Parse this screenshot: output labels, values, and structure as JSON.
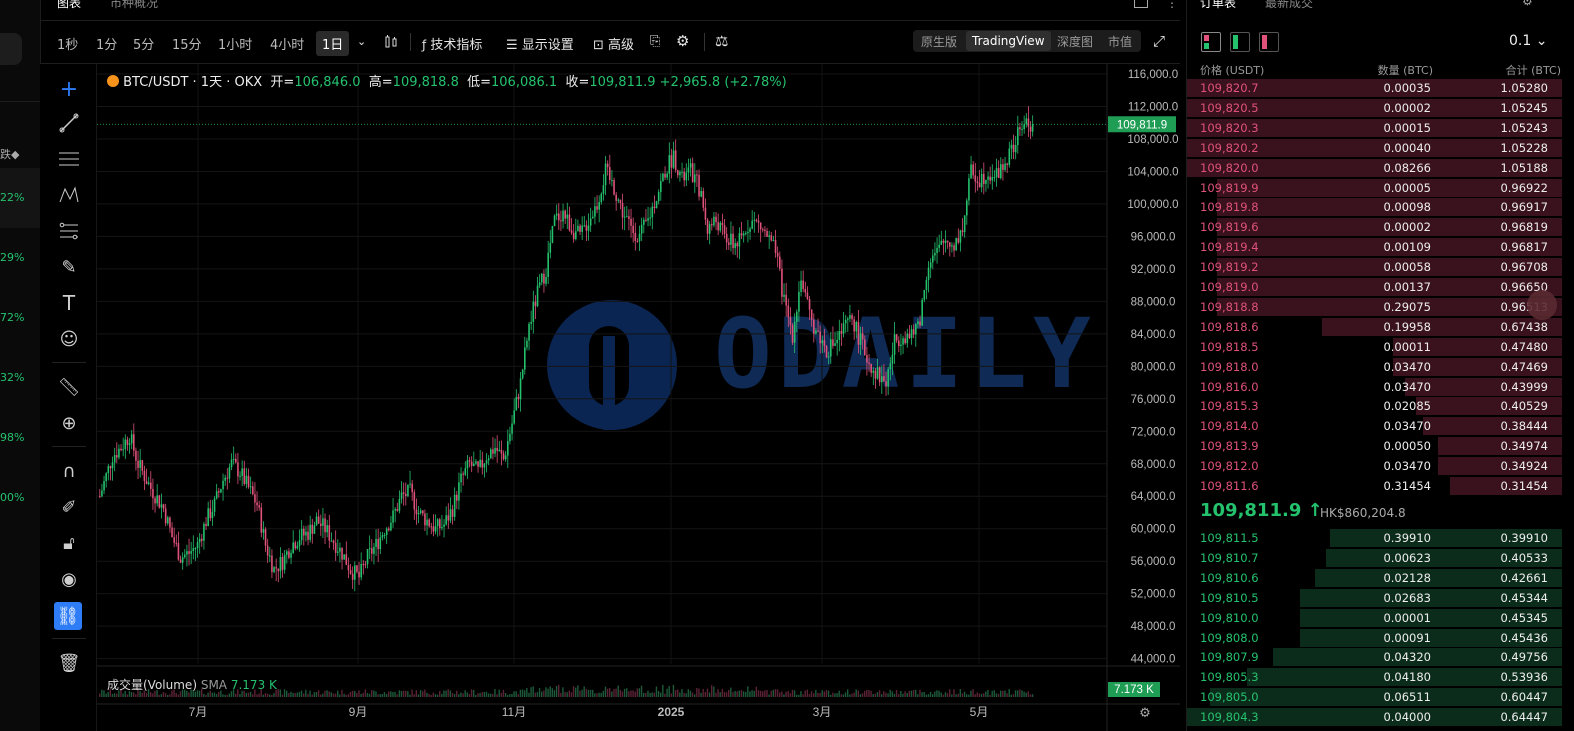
{
  "left_panel": {
    "header": "跌◆",
    "percents": [
      "22%",
      "29%",
      "72%",
      "32%",
      "98%",
      "00%"
    ]
  },
  "top_tabs": [
    "图表",
    "市种概况"
  ],
  "toolbar": {
    "timeframes": [
      "1秒",
      "1分",
      "5分",
      "15分",
      "1小时",
      "4小时",
      "1日"
    ],
    "active_timeframe": "1日",
    "indicators_label": "技术指标",
    "display_label": "显示设置",
    "advanced_label": "高级",
    "views": [
      "原生版",
      "TradingView",
      "深度图",
      "市值"
    ],
    "active_view": "TradingView"
  },
  "legend": {
    "symbol": "BTC/USDT · 1天 · OKX",
    "open_label": "开=",
    "open": "106,846.0",
    "high_label": "高=",
    "high": "109,818.8",
    "low_label": "低=",
    "low": "106,086.1",
    "close_label": "收=",
    "close": "109,811.9",
    "change": "+2,965.8 (+2.78%)"
  },
  "volume_legend": {
    "name": "成交量(Volume)",
    "sma_label": "SMA",
    "sma_value": "7.173 K"
  },
  "watermark": "ODAILY",
  "chart_data": {
    "type": "candlestick",
    "y_ticks": [
      "116,000.0",
      "112,000.0",
      "108,000.0",
      "104,000.0",
      "100,000.0",
      "96,000.0",
      "92,000.0",
      "88,000.0",
      "84,000.0",
      "80,000.0",
      "76,000.0",
      "72,000.0",
      "68,000.0",
      "64,000.0",
      "60,000.0",
      "56,000.0",
      "52,000.0",
      "48,000.0",
      "44,000.0"
    ],
    "x_ticks": [
      "7月",
      "9月",
      "11月",
      "2025",
      "3月",
      "5月"
    ],
    "last_price_label": "109,811.9",
    "volume_label": "7.173 K",
    "ylim": [
      43000,
      117000
    ],
    "path": [
      [
        0,
        64
      ],
      [
        6,
        69
      ],
      [
        10,
        70
      ],
      [
        14,
        71.5
      ],
      [
        18,
        68
      ],
      [
        24,
        65
      ],
      [
        30,
        62.5
      ],
      [
        34,
        59
      ],
      [
        38,
        56.5
      ],
      [
        42,
        57
      ],
      [
        46,
        58
      ],
      [
        50,
        61
      ],
      [
        54,
        63
      ],
      [
        58,
        66
      ],
      [
        62,
        68
      ],
      [
        66,
        67
      ],
      [
        70,
        65
      ],
      [
        74,
        63
      ],
      [
        78,
        58
      ],
      [
        82,
        55
      ],
      [
        86,
        56
      ],
      [
        90,
        58
      ],
      [
        94,
        59
      ],
      [
        98,
        59.5
      ],
      [
        102,
        61
      ],
      [
        106,
        60
      ],
      [
        110,
        58.5
      ],
      [
        114,
        57
      ],
      [
        118,
        55
      ],
      [
        122,
        54
      ],
      [
        126,
        56.5
      ],
      [
        130,
        58
      ],
      [
        134,
        60
      ],
      [
        138,
        61.5
      ],
      [
        142,
        64
      ],
      [
        146,
        64.5
      ],
      [
        150,
        62
      ],
      [
        154,
        61
      ],
      [
        158,
        60
      ],
      [
        162,
        60.5
      ],
      [
        166,
        62.5
      ],
      [
        170,
        66
      ],
      [
        174,
        68
      ],
      [
        178,
        67
      ],
      [
        182,
        69
      ],
      [
        186,
        70
      ],
      [
        190,
        68.5
      ],
      [
        194,
        73
      ],
      [
        198,
        78
      ],
      [
        202,
        85
      ],
      [
        206,
        89
      ],
      [
        210,
        92
      ],
      [
        214,
        98
      ],
      [
        218,
        99
      ],
      [
        222,
        97
      ],
      [
        226,
        96
      ],
      [
        230,
        98
      ],
      [
        234,
        100
      ],
      [
        238,
        104
      ],
      [
        242,
        102
      ],
      [
        246,
        99
      ],
      [
        250,
        97
      ],
      [
        254,
        96
      ],
      [
        258,
        98
      ],
      [
        262,
        101
      ],
      [
        266,
        104
      ],
      [
        270,
        106
      ],
      [
        274,
        103
      ],
      [
        278,
        104
      ],
      [
        282,
        102
      ],
      [
        286,
        97
      ],
      [
        290,
        98
      ],
      [
        294,
        96
      ],
      [
        298,
        95
      ],
      [
        302,
        95.5
      ],
      [
        306,
        98
      ],
      [
        310,
        97.5
      ],
      [
        314,
        96
      ],
      [
        318,
        94
      ],
      [
        322,
        88
      ],
      [
        326,
        84
      ],
      [
        330,
        91
      ],
      [
        334,
        86
      ],
      [
        338,
        84
      ],
      [
        342,
        82
      ],
      [
        346,
        83
      ],
      [
        350,
        84.5
      ],
      [
        354,
        86
      ],
      [
        358,
        83
      ],
      [
        362,
        80.5
      ],
      [
        366,
        79
      ],
      [
        370,
        78
      ],
      [
        374,
        83
      ],
      [
        378,
        84
      ],
      [
        382,
        83.5
      ],
      [
        386,
        86
      ],
      [
        390,
        93
      ],
      [
        394,
        94
      ],
      [
        398,
        95.5
      ],
      [
        402,
        95
      ],
      [
        406,
        97
      ],
      [
        410,
        104
      ],
      [
        414,
        103
      ],
      [
        418,
        104
      ],
      [
        422,
        103.5
      ],
      [
        426,
        105
      ],
      [
        430,
        107
      ],
      [
        434,
        109.8
      ]
    ]
  },
  "orderbook": {
    "tabs": [
      "订单表",
      "最新成交"
    ],
    "tick_size": "0.1",
    "col_price": "价格 (USDT)",
    "col_qty": "数量 (BTC)",
    "col_total": "合计 (BTC)",
    "asks": [
      {
        "price": "109,820.7",
        "qty": "0.00035",
        "total": "1.05280",
        "depth": 1.0
      },
      {
        "price": "109,820.5",
        "qty": "0.00002",
        "total": "1.05245",
        "depth": 1.0
      },
      {
        "price": "109,820.3",
        "qty": "0.00015",
        "total": "1.05243",
        "depth": 1.0
      },
      {
        "price": "109,820.2",
        "qty": "0.00040",
        "total": "1.05228",
        "depth": 1.0
      },
      {
        "price": "109,820.0",
        "qty": "0.08266",
        "total": "1.05188",
        "depth": 1.0
      },
      {
        "price": "109,819.9",
        "qty": "0.00005",
        "total": "0.96922",
        "depth": 0.92
      },
      {
        "price": "109,819.8",
        "qty": "0.00098",
        "total": "0.96917",
        "depth": 0.92
      },
      {
        "price": "109,819.6",
        "qty": "0.00002",
        "total": "0.96819",
        "depth": 0.92
      },
      {
        "price": "109,819.4",
        "qty": "0.00109",
        "total": "0.96817",
        "depth": 0.92
      },
      {
        "price": "109,819.2",
        "qty": "0.00058",
        "total": "0.96708",
        "depth": 0.92
      },
      {
        "price": "109,819.0",
        "qty": "0.00137",
        "total": "0.96650",
        "depth": 0.92
      },
      {
        "price": "109,818.8",
        "qty": "0.29075",
        "total": "0.96513",
        "depth": 0.92
      },
      {
        "price": "109,818.6",
        "qty": "0.19958",
        "total": "0.67438",
        "depth": 0.64
      },
      {
        "price": "109,818.5",
        "qty": "0.00011",
        "total": "0.47480",
        "depth": 0.45
      },
      {
        "price": "109,818.0",
        "qty": "0.03470",
        "total": "0.47469",
        "depth": 0.45
      },
      {
        "price": "109,816.0",
        "qty": "0.03470",
        "total": "0.43999",
        "depth": 0.42
      },
      {
        "price": "109,815.3",
        "qty": "0.02085",
        "total": "0.40529",
        "depth": 0.39
      },
      {
        "price": "109,814.0",
        "qty": "0.03470",
        "total": "0.38444",
        "depth": 0.37
      },
      {
        "price": "109,813.9",
        "qty": "0.00050",
        "total": "0.34974",
        "depth": 0.33
      },
      {
        "price": "109,812.0",
        "qty": "0.03470",
        "total": "0.34924",
        "depth": 0.33
      },
      {
        "price": "109,811.6",
        "qty": "0.31454",
        "total": "0.31454",
        "depth": 0.3
      }
    ],
    "last_price": "109,811.9 ↑",
    "last_price_hkd": "HK$860,204.8",
    "bids": [
      {
        "price": "109,811.5",
        "qty": "0.39910",
        "total": "0.39910",
        "depth": 0.62
      },
      {
        "price": "109,810.7",
        "qty": "0.00623",
        "total": "0.40533",
        "depth": 0.63
      },
      {
        "price": "109,810.6",
        "qty": "0.02128",
        "total": "0.42661",
        "depth": 0.66
      },
      {
        "price": "109,810.5",
        "qty": "0.02683",
        "total": "0.45344",
        "depth": 0.7
      },
      {
        "price": "109,810.0",
        "qty": "0.00001",
        "total": "0.45345",
        "depth": 0.7
      },
      {
        "price": "109,808.0",
        "qty": "0.00091",
        "total": "0.45436",
        "depth": 0.7
      },
      {
        "price": "109,807.9",
        "qty": "0.04320",
        "total": "0.49756",
        "depth": 0.77
      },
      {
        "price": "109,805.3",
        "qty": "0.04180",
        "total": "0.53936",
        "depth": 0.84
      },
      {
        "price": "109,805.0",
        "qty": "0.06511",
        "total": "0.60447",
        "depth": 0.94
      },
      {
        "price": "109,804.3",
        "qty": "0.04000",
        "total": "0.64447",
        "depth": 1.0
      }
    ]
  },
  "colors": {
    "up": "#25c26e",
    "down": "#e0527a",
    "ask_bg": "#3a121e",
    "bid_bg": "#0c2c1b"
  }
}
